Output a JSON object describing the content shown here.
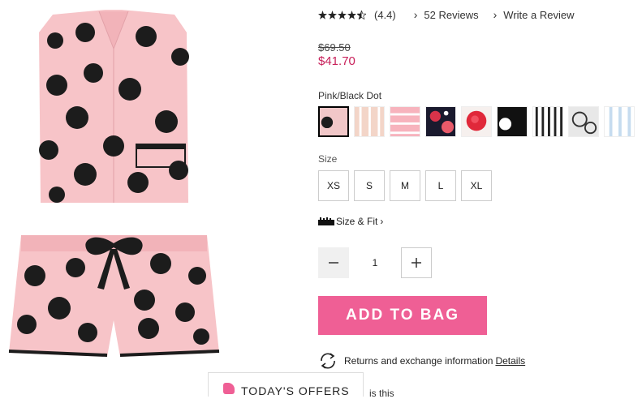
{
  "product": {
    "rating_value": "(4.4)",
    "rating_stars": 4.4,
    "reviews_label": "52 Reviews",
    "write_review_label": "Write a Review",
    "original_price": "$69.50",
    "sale_price": "$41.70",
    "color_name": "Pink/Black Dot",
    "size_label": "Size",
    "sizes": [
      "XS",
      "S",
      "M",
      "L",
      "XL"
    ],
    "size_fit_label": "Size & Fit",
    "quantity": "1",
    "add_to_bag_label": "ADD TO BAG",
    "returns_text": "Returns and exchange information",
    "details_label": "Details"
  },
  "swatches": [
    {
      "name": "pink-black-dot",
      "selected": true
    },
    {
      "name": "peach-stripe"
    },
    {
      "name": "pink-stripe"
    },
    {
      "name": "navy-floral"
    },
    {
      "name": "red-floral"
    },
    {
      "name": "black-white-dot"
    },
    {
      "name": "black-white-stripe"
    },
    {
      "name": "grey-rose"
    },
    {
      "name": "blue-stripe"
    }
  ],
  "offers": {
    "label": "TODAY'S OFFERS",
    "partial_text": "is this"
  },
  "colors": {
    "accent": "#ef5f95",
    "sale": "#c8205a",
    "pajama_pink": "#f7c4c8",
    "dot": "#1c1c1c"
  }
}
